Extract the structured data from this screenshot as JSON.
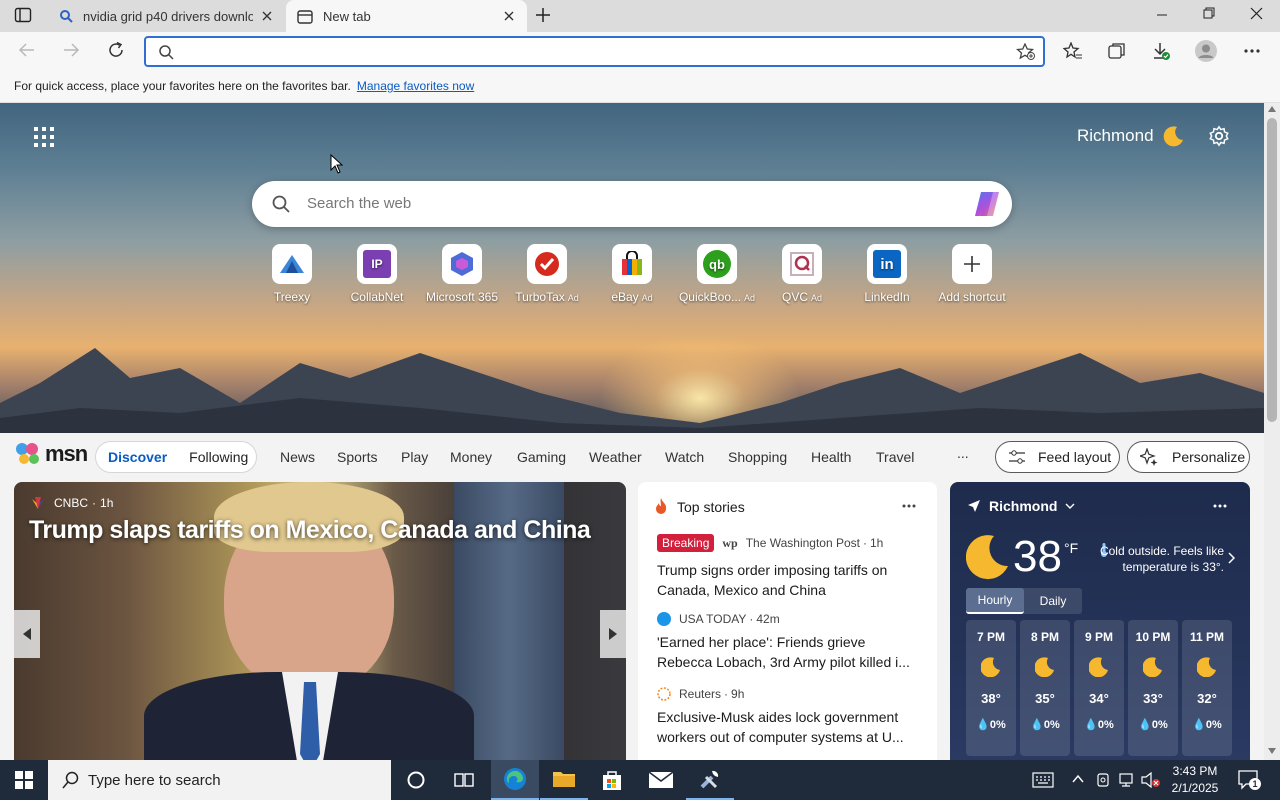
{
  "browser": {
    "tabs": [
      {
        "title": "nvidia grid p40 drivers downloa",
        "active": false
      },
      {
        "title": "New tab",
        "active": true
      }
    ],
    "address_value": "",
    "favorites_bar": {
      "message": "For quick access, place your favorites here on the favorites bar.",
      "link": "Manage favorites now"
    }
  },
  "newtab": {
    "location": "Richmond",
    "search_placeholder": "Search the web",
    "shortcuts": [
      {
        "label": "Treexy",
        "ad": "",
        "icon": "treexy-icon"
      },
      {
        "label": "CollabNet",
        "ad": "",
        "icon": "collabnet-icon"
      },
      {
        "label": "Microsoft 365",
        "ad": "",
        "icon": "microsoft365-icon"
      },
      {
        "label": "TurboTax",
        "ad": "Ad",
        "icon": "turbotax-icon"
      },
      {
        "label": "eBay",
        "ad": "Ad",
        "icon": "ebay-icon"
      },
      {
        "label": "QuickBoo...",
        "ad": "Ad",
        "icon": "quickbooks-icon"
      },
      {
        "label": "QVC",
        "ad": "Ad",
        "icon": "qvc-icon"
      },
      {
        "label": "LinkedIn",
        "ad": "",
        "icon": "linkedin-icon"
      },
      {
        "label": "Add shortcut",
        "ad": "",
        "icon": "plus-icon"
      }
    ]
  },
  "msn": {
    "logo": "msn",
    "feed_tabs": [
      "Discover",
      "Following"
    ],
    "nav": [
      "News",
      "Sports",
      "Play",
      "Money",
      "Gaming",
      "Weather",
      "Watch",
      "Shopping",
      "Health",
      "Travel"
    ],
    "more": "...",
    "feed_layout": "Feed layout",
    "personalize": "Personalize",
    "hero": {
      "source": "CNBC",
      "age": "1h",
      "headline": "Trump slaps tariffs on Mexico, Canada and China"
    },
    "top_stories": {
      "title": "Top stories",
      "items": [
        {
          "badge": "Breaking",
          "source": "The Washington Post",
          "age": "1h",
          "headline": "Trump signs order imposing tariffs on Canada, Mexico and China"
        },
        {
          "badge": "",
          "source": "USA TODAY",
          "age": "42m",
          "headline": "'Earned her place': Friends grieve Rebecca Lobach, 3rd Army pilot killed i..."
        },
        {
          "badge": "",
          "source": "Reuters",
          "age": "9h",
          "headline": "Exclusive-Musk aides lock government workers out of computer systems at U..."
        }
      ]
    },
    "weather": {
      "location": "Richmond",
      "temp": "38",
      "unit": "°F",
      "note": "Cold outside. Feels like temperature is 33°.",
      "tabs": [
        "Hourly",
        "Daily"
      ],
      "hours": [
        {
          "time": "7 PM",
          "temp": "38°",
          "precip": "0%"
        },
        {
          "time": "8 PM",
          "temp": "35°",
          "precip": "0%"
        },
        {
          "time": "9 PM",
          "temp": "34°",
          "precip": "0%"
        },
        {
          "time": "10 PM",
          "temp": "33°",
          "precip": "0%"
        },
        {
          "time": "11 PM",
          "temp": "32°",
          "precip": "0%"
        }
      ]
    }
  },
  "taskbar": {
    "search_placeholder": "Type here to search",
    "time": "3:43 PM",
    "date": "2/1/2025",
    "notifications": "1"
  }
}
